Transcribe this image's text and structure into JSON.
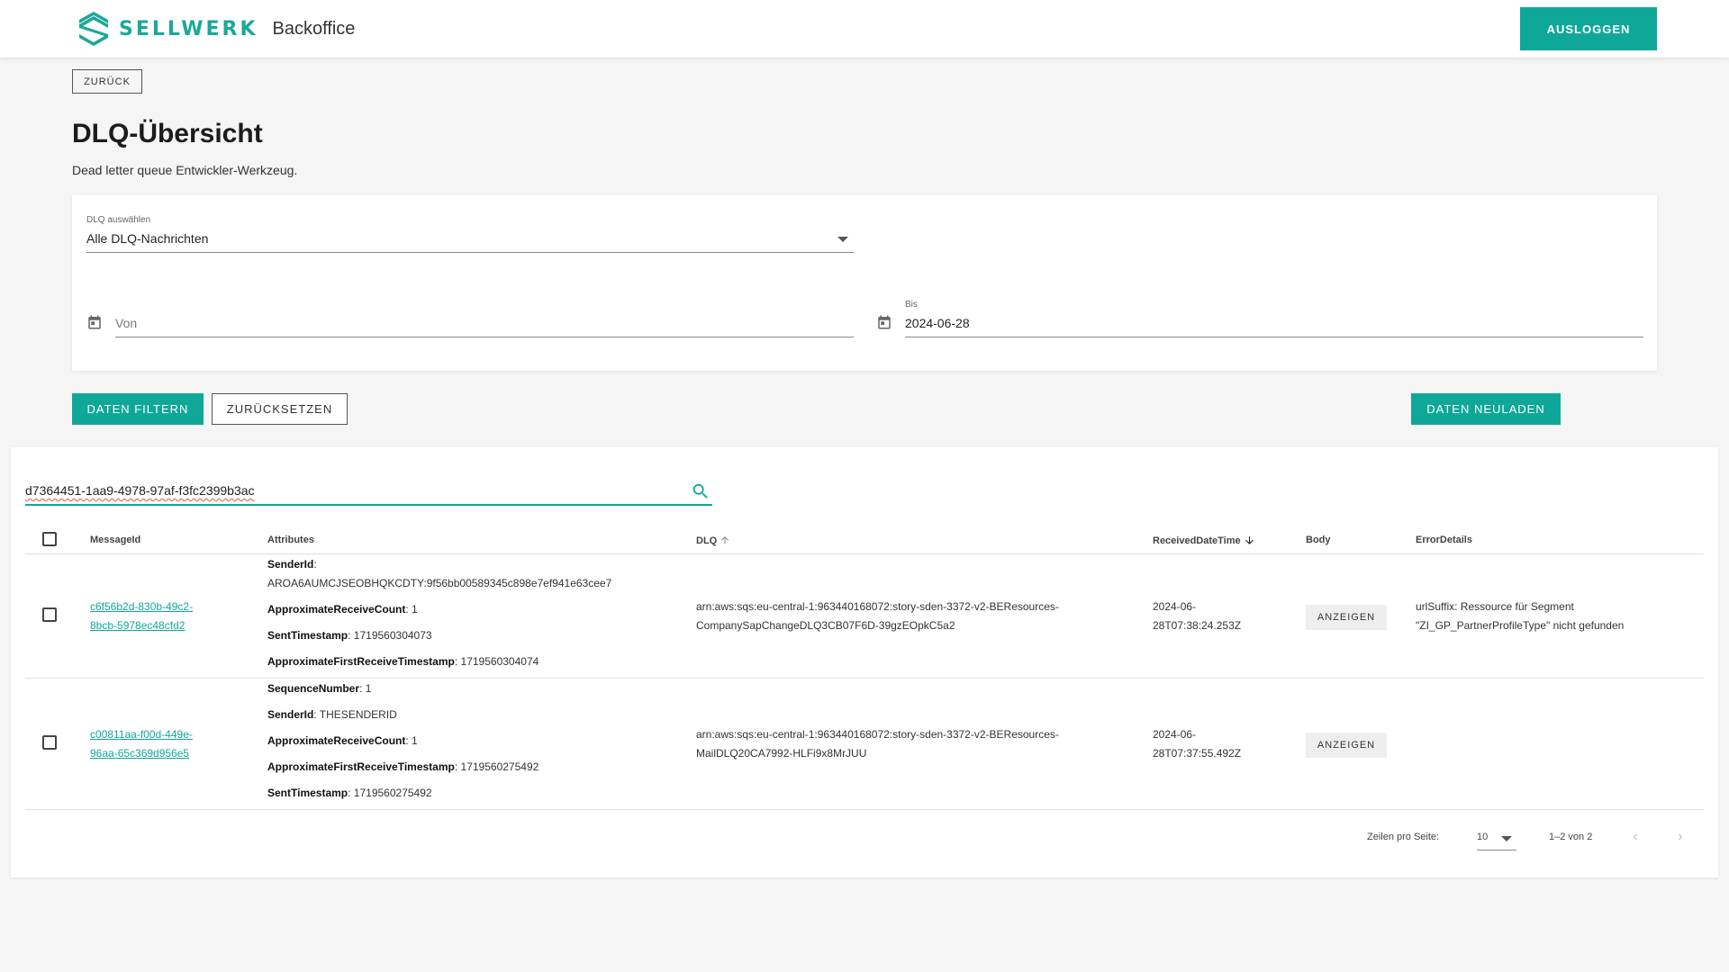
{
  "header": {
    "brand": "SELLWERK",
    "subtitle": "Backoffice",
    "logout_label": "AUSLOGGEN",
    "accent": "#0fa898"
  },
  "back_label": "ZURÜCK",
  "page": {
    "title": "DLQ-Übersicht",
    "description": "Dead letter queue Entwickler-Werkzeug."
  },
  "filter": {
    "dlq_label": "DLQ auswählen",
    "dlq_value": "Alle DLQ-Nachrichten",
    "from_placeholder": "Von",
    "to_label": "Bis",
    "to_value": "2024-06-28"
  },
  "actions": {
    "filter_label": "DATEN FILTERN",
    "reset_label": "ZURÜCKSETZEN",
    "reload_label": "DATEN NEULADEN"
  },
  "search": {
    "value": "d7364451-1aa9-4978-97af-f3fc2399b3ac"
  },
  "table": {
    "columns": {
      "message_id": "MessageId",
      "attributes": "Attributes",
      "dlq": "DLQ",
      "received": "ReceivedDateTime",
      "body": "Body",
      "error": "ErrorDetails"
    },
    "rows": [
      {
        "id_line1": "c6f56b2d-830b-49c2-",
        "id_line2": "8bcb-5978ec48cfd2",
        "attrs": [
          {
            "key": "SenderId",
            "value": ""
          },
          {
            "key": "",
            "value": "AROA6AUMCJSEOBHQKCDTY:9f56bb00589345c898e7ef941e63cee7"
          },
          {
            "key": "ApproximateReceiveCount",
            "value": ": 1"
          },
          {
            "key": "SentTimestamp",
            "value": ": 1719560304073"
          },
          {
            "key": "ApproximateFirstReceiveTimestamp",
            "value": ": 1719560304074"
          }
        ],
        "dlq_line1": "arn:aws:sqs:eu-central-1:963440168072:story-sden-3372-v2-BEResources-",
        "dlq_line2": "CompanySapChangeDLQ3CB07F6D-39gzEOpkC5a2",
        "received_line1": "2024-06-",
        "received_line2": "28T07:38:24.253Z",
        "body_label": "ANZEIGEN",
        "error_line1": "urlSuffix: Ressource für Segment",
        "error_line2": "\"ZI_GP_PartnerProfileType\" nicht gefunden"
      },
      {
        "id_line1": "c00811aa-f00d-449e-",
        "id_line2": "96aa-65c369d956e5",
        "attrs": [
          {
            "key": "SequenceNumber",
            "value": ": 1"
          },
          {
            "key": "SenderId",
            "value": ": THESENDERID"
          },
          {
            "key": "ApproximateReceiveCount",
            "value": ": 1"
          },
          {
            "key": "ApproximateFirstReceiveTimestamp",
            "value": ": 1719560275492"
          },
          {
            "key": "SentTimestamp",
            "value": ": 1719560275492"
          }
        ],
        "dlq_line1": "arn:aws:sqs:eu-central-1:963440168072:story-sden-3372-v2-BEResources-",
        "dlq_line2": "MailDLQ20CA7992-HLFi9x8MrJUU",
        "received_line1": "2024-06-",
        "received_line2": "28T07:37:55.492Z",
        "body_label": "ANZEIGEN",
        "error_line1": "",
        "error_line2": ""
      }
    ]
  },
  "pagination": {
    "rows_label": "Zeilen pro Seite:",
    "rows_value": "10",
    "range": "1–2 von 2"
  }
}
